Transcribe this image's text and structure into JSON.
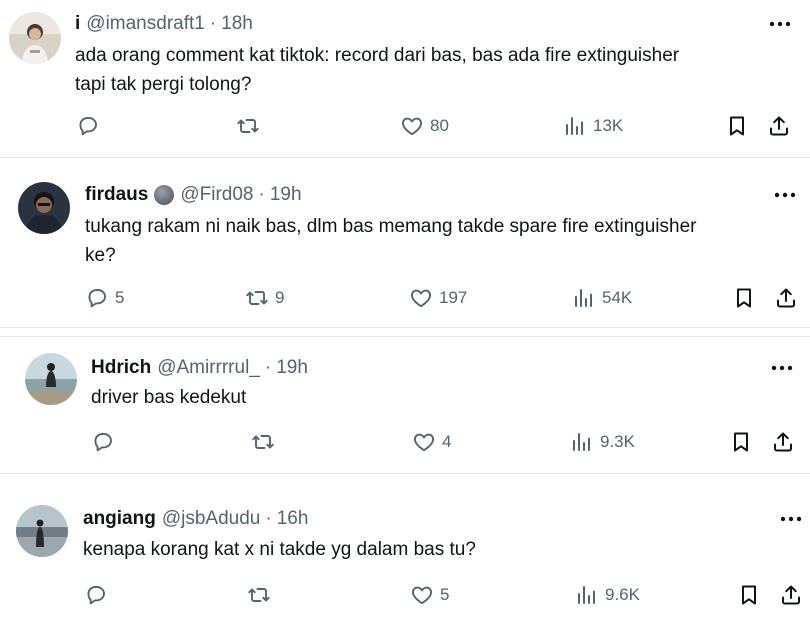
{
  "tweets": [
    {
      "name": "i",
      "handle": "@imansdraft1",
      "sep": "·",
      "time": "18h",
      "text_lines": [
        "ada orang comment kat tiktok: record dari bas, bas ada fire extinguisher",
        "tapi tak pergi tolong?"
      ],
      "replies": "",
      "reposts": "",
      "likes": "80",
      "views": "13K"
    },
    {
      "name": "firdaus",
      "handle": "@Fird08",
      "sep": "·",
      "time": "19h",
      "text_lines": [
        "tukang rakam ni naik bas, dlm bas memang takde spare fire extinguisher",
        "ke?"
      ],
      "replies": "5",
      "reposts": "9",
      "likes": "197",
      "views": "54K"
    },
    {
      "name": "Hdrich",
      "handle": "@Amirrrrul_",
      "sep": "·",
      "time": "19h",
      "text_lines": [
        "driver bas kedekut"
      ],
      "replies": "",
      "reposts": "",
      "likes": "4",
      "views": "9.3K"
    },
    {
      "name": "angiang",
      "handle": "@jsbAdudu",
      "sep": "·",
      "time": "16h",
      "text_lines": [
        "kenapa korang kat x ni takde yg dalam bas tu?"
      ],
      "replies": "",
      "reposts": "",
      "likes": "5",
      "views": "9.6K"
    }
  ],
  "icons": {
    "reply": "speech-bubble-icon",
    "repost": "repost-arrows-icon",
    "like": "heart-icon",
    "views": "bar-chart-icon",
    "bookmark": "bookmark-icon",
    "share": "share-upload-icon",
    "more": "more-dots-icon"
  },
  "colors": {
    "text": "#0f1419",
    "muted": "#536471",
    "divider": "#e6e9eb",
    "background": "#ffffff"
  }
}
